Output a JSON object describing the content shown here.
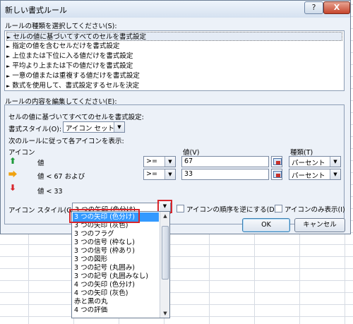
{
  "window": {
    "title": "新しい書式ルール",
    "help": "?",
    "close": "X"
  },
  "rule_type_label": "ルールの種類を選択してください(S):",
  "rule_types": [
    "セルの値に基づいてすべてのセルを書式設定",
    "指定の値を含むセルだけを書式設定",
    "上位または下位に入る値だけを書式設定",
    "平均より上または下の値だけを書式設定",
    "一意の値または重複する値だけを書式設定",
    "数式を使用して、書式設定するセルを決定"
  ],
  "edit_label": "ルールの内容を編集してください(E):",
  "edit": {
    "subtitle": "セルの値に基づいてすべてのセルを書式設定:",
    "style_label": "書式スタイル(O):",
    "style_value": "アイコン セット",
    "rule_hint": "次のルールに従って各アイコンを表示:",
    "icon_header": "アイコン",
    "value_header": "値(V)",
    "type_header": "種類(T)",
    "rows": [
      {
        "icon": "arrow-up-icon",
        "color": "#1e9a3a",
        "glyph": "⬆",
        "label": "値",
        "op": ">=",
        "value": "67",
        "type": "パーセント"
      },
      {
        "icon": "arrow-right-icon",
        "color": "#f0a20f",
        "glyph": "⮕",
        "label": "値 < 67 および",
        "op": ">=",
        "value": "33",
        "type": "パーセント"
      },
      {
        "icon": "arrow-down-icon",
        "color": "#d8262c",
        "glyph": "⬇",
        "label": "値 < 33"
      }
    ],
    "icon_style_label": "アイコン スタイル(G):",
    "icon_style_value": "3 つの矢印 (色分け)",
    "reverse_label": "アイコンの順序を逆にする(D)",
    "icon_only_label": "アイコンのみ表示(I)"
  },
  "buttons": {
    "ok": "OK",
    "cancel": "キャンセル"
  },
  "dropdown_options": [
    "3 つの矢印 (色分け)",
    "3 つの矢印 (灰色)",
    "3 つのフラグ",
    "3 つの信号 (枠なし)",
    "3 つの信号 (枠あり)",
    "3 つの図形",
    "3 つの記号 (丸囲み)",
    "3 つの記号 (丸囲みなし)",
    "4 つの矢印 (色分け)",
    "4 つの矢印 (灰色)",
    "赤と黒の丸",
    "4 つの評価"
  ],
  "colors": {
    "highlight": "#d9262c",
    "selection": "#3399ff"
  }
}
